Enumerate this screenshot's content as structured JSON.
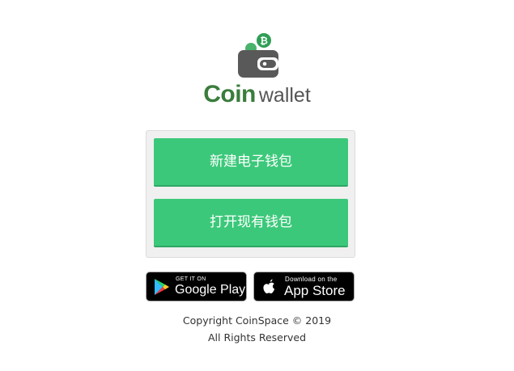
{
  "brand": {
    "word1": "Coin",
    "word2": "wallet",
    "coin_symbol": "₿",
    "brand_green": "#3a7d3c",
    "wallet_gray": "#555555"
  },
  "actions": {
    "create_label": "新建电子钱包",
    "open_label": "打开现有钱包",
    "button_color": "#3cc87a"
  },
  "stores": {
    "google": {
      "small": "GET IT ON",
      "big": "Google Play"
    },
    "apple": {
      "small": "Download on the",
      "big": "App Store"
    }
  },
  "footer": {
    "line1": "Copyright CoinSpace © 2019",
    "line2": "All Rights Reserved"
  }
}
